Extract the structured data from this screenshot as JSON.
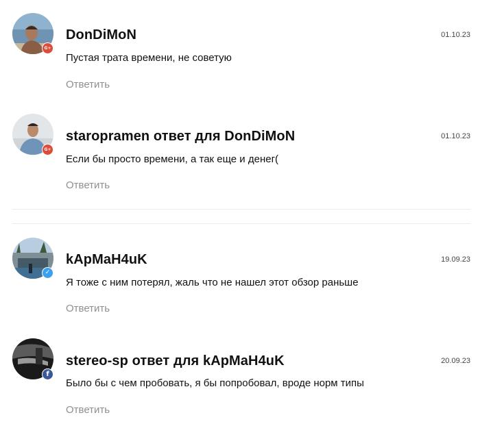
{
  "comments": [
    {
      "author": "DonDiMoN",
      "date": "01.10.23",
      "text": "Пустая трата времени, не советую",
      "reply_label": "Ответить",
      "social": "google-plus",
      "badge_label": "G+",
      "avatar_icon": "user-photo-avatar"
    },
    {
      "author": "staropramen ответ для DonDiMoN",
      "date": "01.10.23",
      "text": "Если бы просто времени, а так еще и денег(",
      "reply_label": "Ответить",
      "social": "google-plus",
      "badge_label": "G+",
      "avatar_icon": "user-photo-avatar"
    },
    {
      "author": "kApMaH4uK",
      "date": "19.09.23",
      "text": "Я тоже с ним потерял, жаль что не нашел этот обзор раньше",
      "reply_label": "Ответить",
      "social": "twitter",
      "badge_label": "",
      "avatar_icon": "user-photo-avatar"
    },
    {
      "author": "stereo-sp ответ для kApMaH4uK",
      "date": "20.09.23",
      "text": "Было бы с чем пробовать, я бы попробовал, вроде норм типы",
      "reply_label": "Ответить",
      "social": "facebook",
      "badge_label": "f",
      "avatar_icon": "user-photo-avatar"
    }
  ],
  "colors": {
    "google": "#dd4b39",
    "twitter": "#3ba1ee",
    "facebook": "#3b5998",
    "reply": "#8f8f8f",
    "divider": "#ebebeb"
  }
}
